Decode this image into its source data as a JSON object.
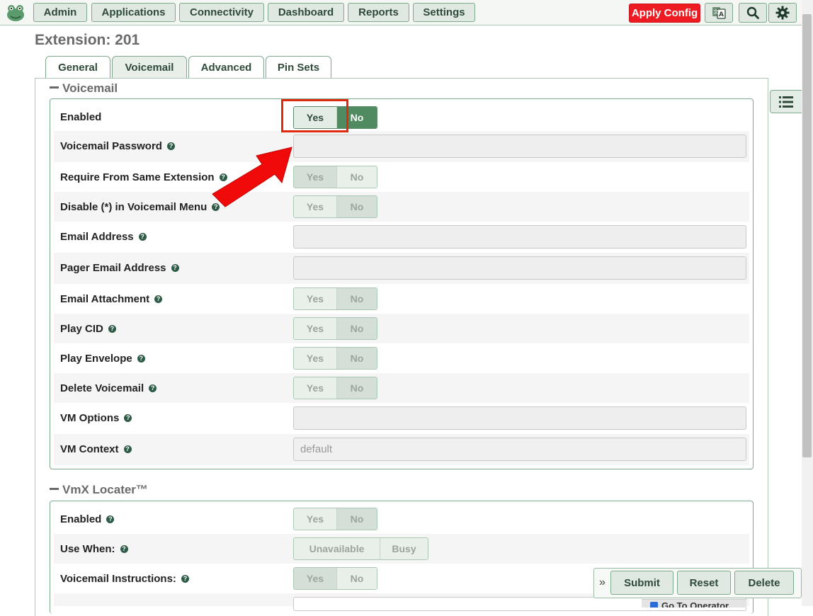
{
  "nav": {
    "items": [
      "Admin",
      "Applications",
      "Connectivity",
      "Dashboard",
      "Reports",
      "Settings"
    ],
    "apply_config": "Apply Config"
  },
  "page_title": "Extension: 201",
  "tabs": [
    "General",
    "Voicemail",
    "Advanced",
    "Pin Sets"
  ],
  "active_tab": "Voicemail",
  "voicemail": {
    "title": "Voicemail",
    "enabled_label": "Enabled",
    "password_label": "Voicemail Password",
    "require_same_ext_label": "Require From Same Extension",
    "disable_star_label": "Disable (*) in Voicemail Menu",
    "email_label": "Email Address",
    "pager_email_label": "Pager Email Address",
    "email_attachment_label": "Email Attachment",
    "play_cid_label": "Play CID",
    "play_envelope_label": "Play Envelope",
    "delete_vm_label": "Delete Voicemail",
    "vm_options_label": "VM Options",
    "vm_context_label": "VM Context",
    "vm_context_placeholder": "default"
  },
  "vmx": {
    "title": "VmX Locater™",
    "enabled_label": "Enabled",
    "use_when_label": "Use When:",
    "instructions_label": "Voicemail Instructions:",
    "unavailable": "Unavailable",
    "busy": "Busy"
  },
  "toggle": {
    "yes": "Yes",
    "no": "No"
  },
  "actions": {
    "submit": "Submit",
    "reset": "Reset",
    "delete": "Delete",
    "expand": "»"
  },
  "goto_operator": "Go To Operator",
  "help_glyph": "?",
  "colors": {
    "accent": "#4f8a60",
    "apply": "#ee1c22",
    "annotation": "#e02a10"
  }
}
